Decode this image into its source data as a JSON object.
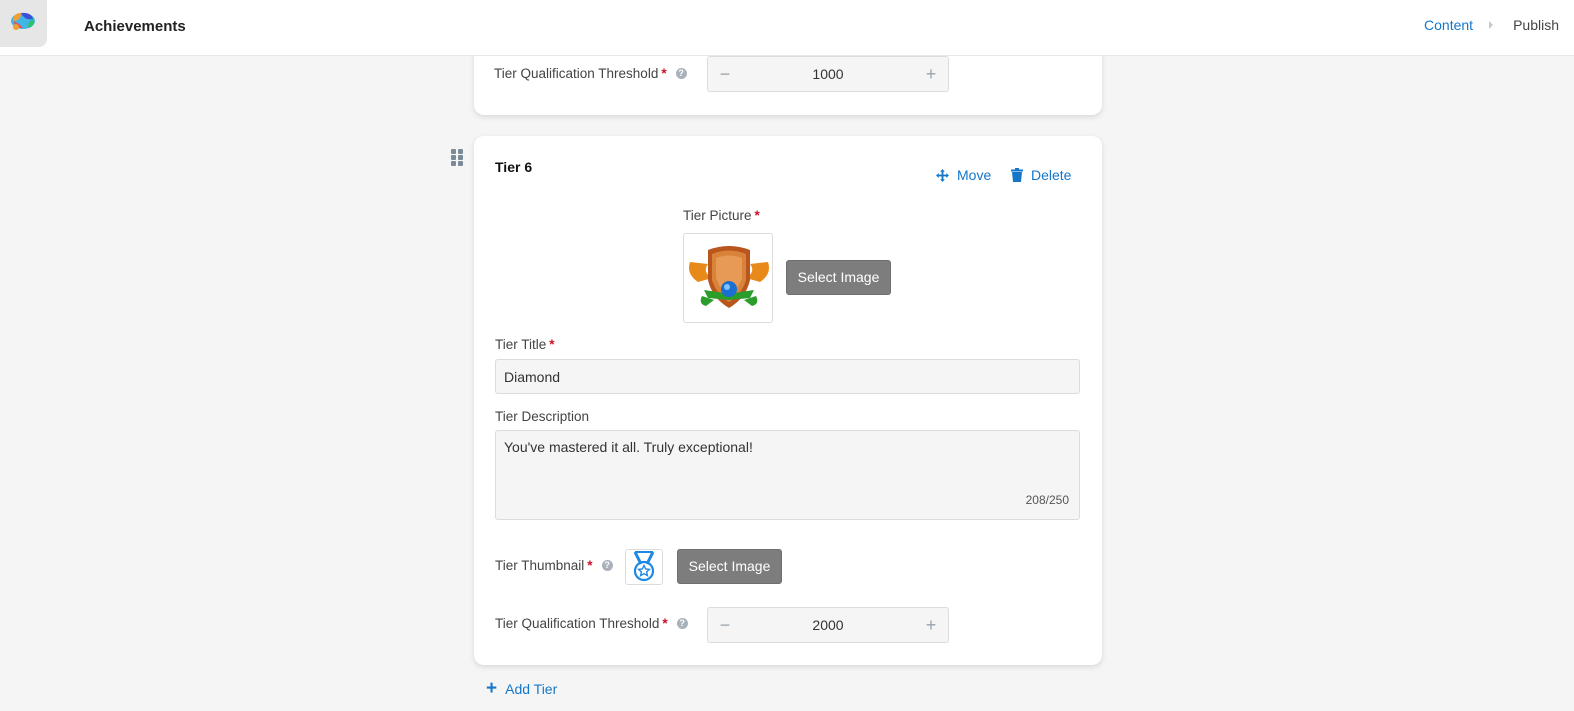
{
  "header": {
    "title": "Achievements",
    "steps": [
      "Content",
      "Publish"
    ]
  },
  "previous_tier": {
    "threshold_label": "Tier Qualification Threshold",
    "threshold_value": "1000"
  },
  "tier": {
    "title": "Tier 6",
    "move_label": "Move",
    "delete_label": "Delete",
    "picture_label": "Tier Picture",
    "select_image_label": "Select Image",
    "title_label": "Tier Title",
    "title_value": "Diamond",
    "description_label": "Tier Description",
    "description_value": "You've mastered it all. Truly exceptional!",
    "description_counter": "208/250",
    "thumbnail_label": "Tier Thumbnail",
    "thumbnail_button_label": "Select Image",
    "threshold_label": "Tier Qualification Threshold",
    "threshold_value": "2000"
  },
  "add_tier_label": "Add Tier",
  "required_marker": "*",
  "colors": {
    "accent": "#1677c9",
    "required": "#d0102a",
    "button_gray": "#7d7d7d"
  },
  "icons": [
    "logo-icon",
    "chevron-right-icon",
    "help-icon",
    "minus-icon",
    "plus-icon",
    "drag-handle-icon",
    "move-icon",
    "trash-icon",
    "tier-badge-image",
    "medal-icon"
  ]
}
